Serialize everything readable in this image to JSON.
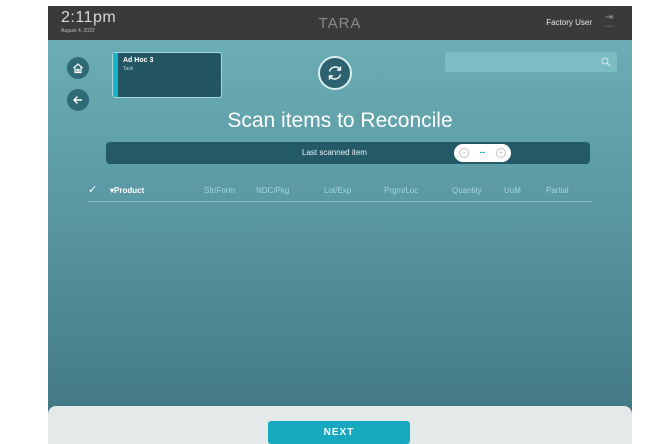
{
  "topbar": {
    "time": "2:11pm",
    "date": "August 4, 2022",
    "app_name": "TARA",
    "user_name": "Factory User",
    "logout_label": "Logout"
  },
  "task": {
    "title": "Ad Hoc 3",
    "subtitle": "Task"
  },
  "search": {
    "placeholder": ""
  },
  "page": {
    "title": "Scan items to Reconcile"
  },
  "scan": {
    "label": "Last scanned item",
    "quantity": "--"
  },
  "table": {
    "columns": [
      "Product",
      "Str/Form",
      "NDC/Pkg",
      "Lot/Exp",
      "Prgm/Loc",
      "Quantity",
      "UoM",
      "Partial"
    ],
    "rows": []
  },
  "footer": {
    "next_label": "NEXT"
  },
  "colors": {
    "accent": "#17a9c0",
    "topbar": "#3a3a3c",
    "card": "#235563"
  }
}
